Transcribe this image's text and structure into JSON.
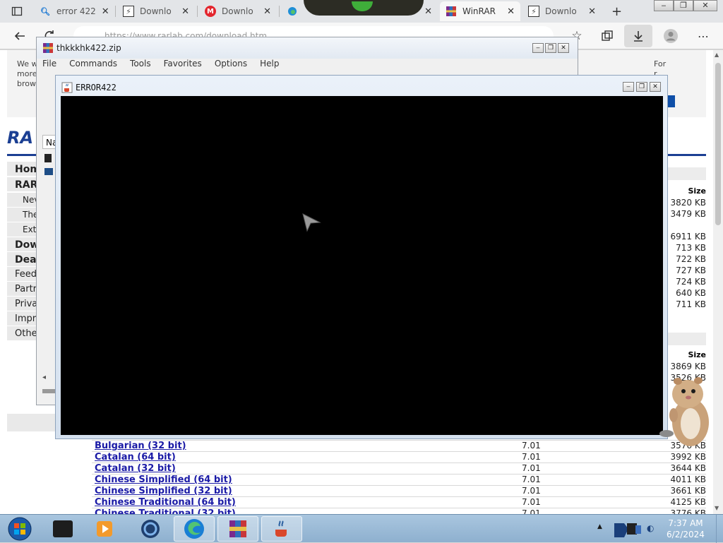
{
  "browser": {
    "tabs": [
      {
        "label": "error 422",
        "icon": "search-icon"
      },
      {
        "label": "Downlo",
        "icon": "download-site-icon"
      },
      {
        "label": "Downlo",
        "icon": "m-site-icon"
      },
      {
        "label": "",
        "icon": "edge-icon"
      },
      {
        "label": "WinRAR",
        "icon": "winrar-icon"
      },
      {
        "label": "Downlo",
        "icon": "download-site-icon"
      }
    ],
    "new_tab": "+",
    "close_glyph": "✕",
    "url": "https://www.rarlab.com/download.htm",
    "accent": "#0078d4"
  },
  "webpage": {
    "intro_lines": [
      "We w",
      "more",
      "brow"
    ],
    "side_lines": [
      "For",
      "r"
    ],
    "logo_text": "RA",
    "nav": [
      {
        "label": "Hom",
        "bold": true
      },
      {
        "label": "RAR",
        "bold": true
      },
      {
        "label": "Nev",
        "sub": true
      },
      {
        "label": "The",
        "sub": true
      },
      {
        "label": "Ext",
        "sub": true
      },
      {
        "label": "Dow",
        "bold": true
      },
      {
        "label": "Deal",
        "bold": true
      },
      {
        "label": "Feed"
      },
      {
        "label": "Partr"
      },
      {
        "label": "Priva"
      },
      {
        "label": "Impri"
      },
      {
        "label": "Othe"
      }
    ],
    "size_header": "Size",
    "sizes_top": [
      "3820 KB",
      "3479 KB",
      "",
      "6911 KB",
      "713 KB",
      "722 KB",
      "727 KB",
      "724 KB",
      "640 KB",
      "711 KB"
    ],
    "sizes_bottom_partial": [
      "3869 KB",
      "3526 KB"
    ],
    "rows": [
      {
        "lang": "Bulgarian (32 bit)",
        "ver": "7.01",
        "size": "3576 KB"
      },
      {
        "lang": "Catalan (64 bit)",
        "ver": "7.01",
        "size": "3992 KB"
      },
      {
        "lang": "Catalan (32 bit)",
        "ver": "7.01",
        "size": "3644 KB"
      },
      {
        "lang": "Chinese Simplified (64 bit)",
        "ver": "7.01",
        "size": "4011 KB"
      },
      {
        "lang": "Chinese Simplified (32 bit)",
        "ver": "7.01",
        "size": "3661 KB"
      },
      {
        "lang": "Chinese Traditional (64 bit)",
        "ver": "7.01",
        "size": "4125 KB"
      },
      {
        "lang": "Chinese Traditional (32 bit)",
        "ver": "7.01",
        "size": "3776 KB"
      }
    ]
  },
  "winrar": {
    "title": "thkkkhk422.zip",
    "menu": [
      "File",
      "Commands",
      "Tools",
      "Favorites",
      "Options",
      "Help"
    ],
    "column_name": "Na",
    "icon": "winrar-icon"
  },
  "java_window": {
    "title": "ERROR422",
    "icon": "java-cup-icon"
  },
  "taskbar": {
    "time": "7:37 AM",
    "date": "6/2/2024",
    "buttons": [
      "start-orb",
      "black-app",
      "media-player",
      "browser-orb",
      "edge",
      "winrar",
      "java"
    ]
  }
}
